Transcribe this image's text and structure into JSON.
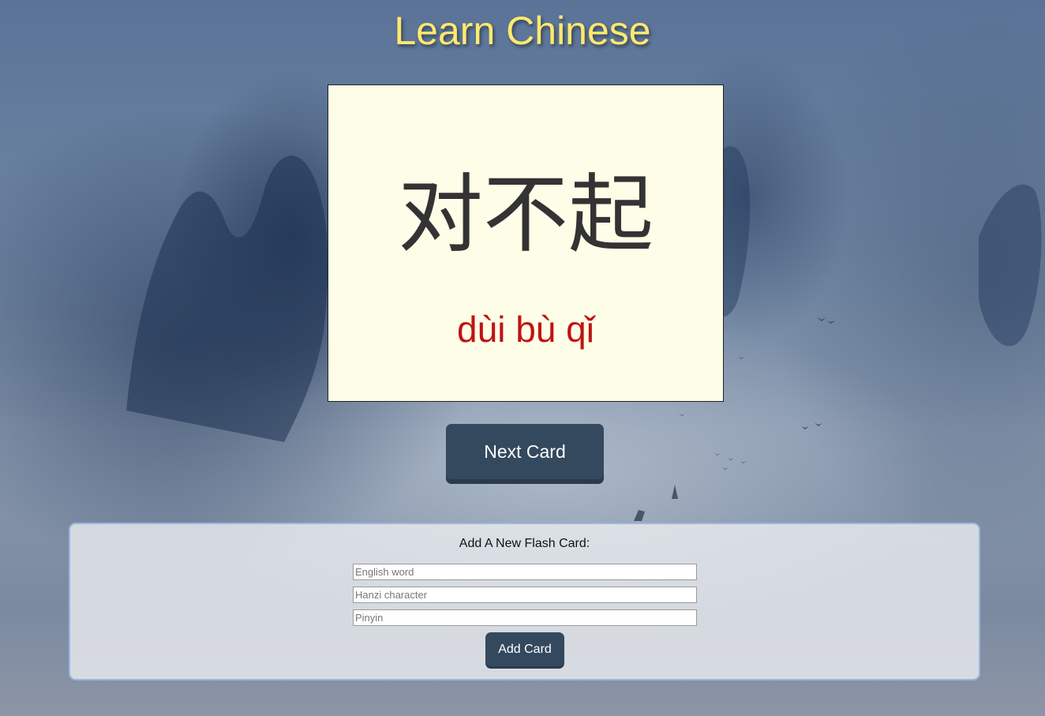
{
  "header": {
    "title": "Learn Chinese"
  },
  "flashcard": {
    "hanzi": "对不起",
    "pinyin": "dùi bù qǐ"
  },
  "controls": {
    "next_label": "Next Card"
  },
  "add_form": {
    "title": "Add A New Flash Card:",
    "english_placeholder": "English word",
    "hanzi_placeholder": "Hanzi character",
    "pinyin_placeholder": "Pinyin",
    "submit_label": "Add Card"
  },
  "colors": {
    "title": "#ffe96e",
    "card_background": "#fdfde8",
    "pinyin": "#c01313",
    "button": "#34495e"
  }
}
